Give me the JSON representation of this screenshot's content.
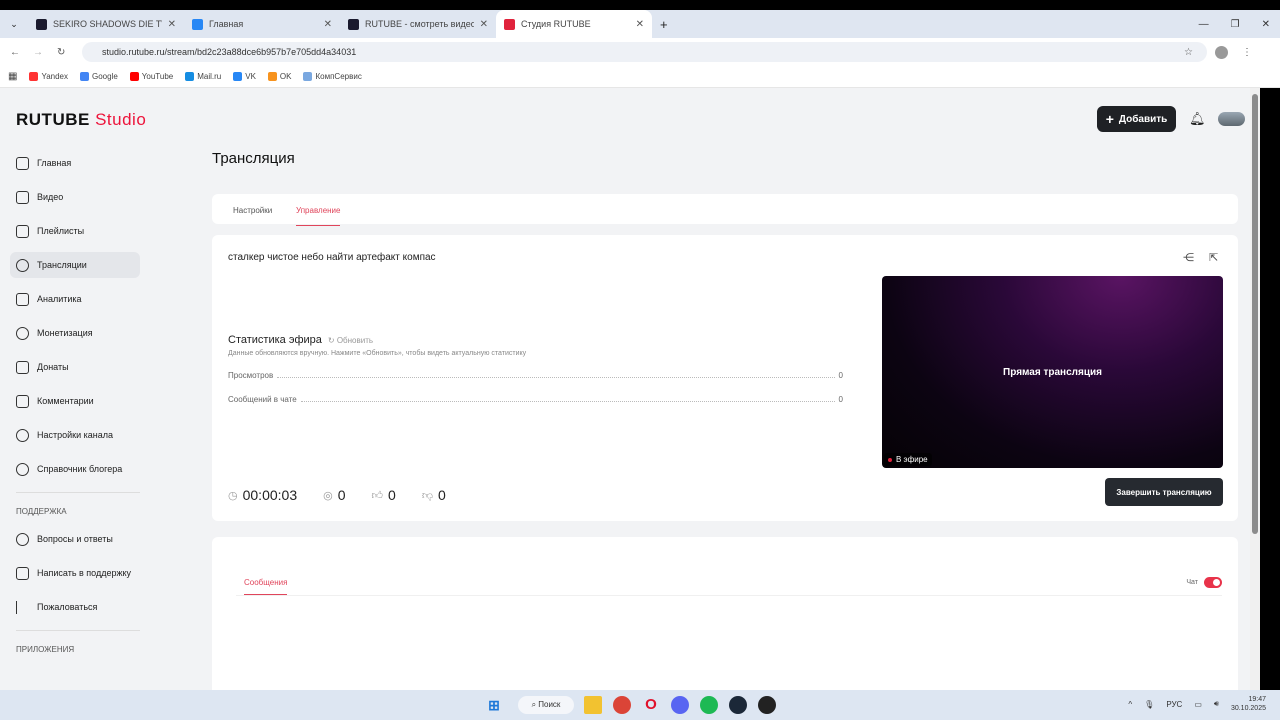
{
  "browser": {
    "tabs": [
      {
        "title": "SEKIRO SHADOWS DIE TWICE",
        "color": "#1a1a2e"
      },
      {
        "title": "Главная",
        "color": "#2787f5"
      },
      {
        "title": "RUTUBE - смотреть видео он",
        "color": "#1a1a2e"
      },
      {
        "title": "Студия RUTUBE",
        "color": "#e0233c"
      }
    ],
    "new_tab": "+",
    "url": "studio.rutube.ru/stream/bd2c23a88dce6b957b7e705dd4a34031",
    "bookmarks": [
      {
        "label": "Yandex",
        "color": "#f33"
      },
      {
        "label": "Google",
        "color": "#4285f4"
      },
      {
        "label": "YouTube",
        "color": "#f00"
      },
      {
        "label": "Mail.ru",
        "color": "#168de2"
      },
      {
        "label": "VK",
        "color": "#2787f5"
      },
      {
        "label": "OK",
        "color": "#f7931e"
      },
      {
        "label": "КомпСервис",
        "color": "#7aa8e0"
      }
    ]
  },
  "app": {
    "logo_main": "RUTUBE",
    "logo_studio": "Studio",
    "add_button": "Добавить",
    "sidebar": {
      "items": [
        "Главная",
        "Видео",
        "Плейлисты",
        "Трансляции",
        "Аналитика",
        "Монетизация",
        "Донаты",
        "Комментарии",
        "Настройки канала",
        "Справочник блогера"
      ],
      "active": "Трансляции",
      "support_heading": "ПОДДЕРЖКА",
      "support_items": [
        "Вопросы и ответы",
        "Написать в поддержку",
        "Пожаловаться"
      ],
      "apps_heading": "ПРИЛОЖЕНИЯ"
    },
    "page_title": "Трансляция",
    "tabs": [
      "Настройки",
      "Управление"
    ],
    "active_tab": "Управление",
    "stream": {
      "title": "сталкер чистое небо найти артефакт компас",
      "stats_heading": "Статистика эфира",
      "refresh": "Обновить",
      "note": "Данные обновляются вручную. Нажмите «Обновить», чтобы видеть актуальную статистику",
      "rows": [
        {
          "label": "Просмотров",
          "value": "0"
        },
        {
          "label": "Сообщений в чате",
          "value": "0"
        }
      ],
      "preview_label": "Прямая трансляция",
      "on_air": "В эфире",
      "duration": "00:00:03",
      "viewers": "0",
      "likes": "0",
      "dislikes": "0",
      "end_button": "Завершить трансляцию"
    },
    "chat": {
      "tab": "Сообщения",
      "toggle_label": "Чат",
      "toggle_on": true
    }
  },
  "taskbar": {
    "search": "Поиск",
    "lang": "РУС",
    "time": "19:47",
    "date": "30.10.2025"
  }
}
